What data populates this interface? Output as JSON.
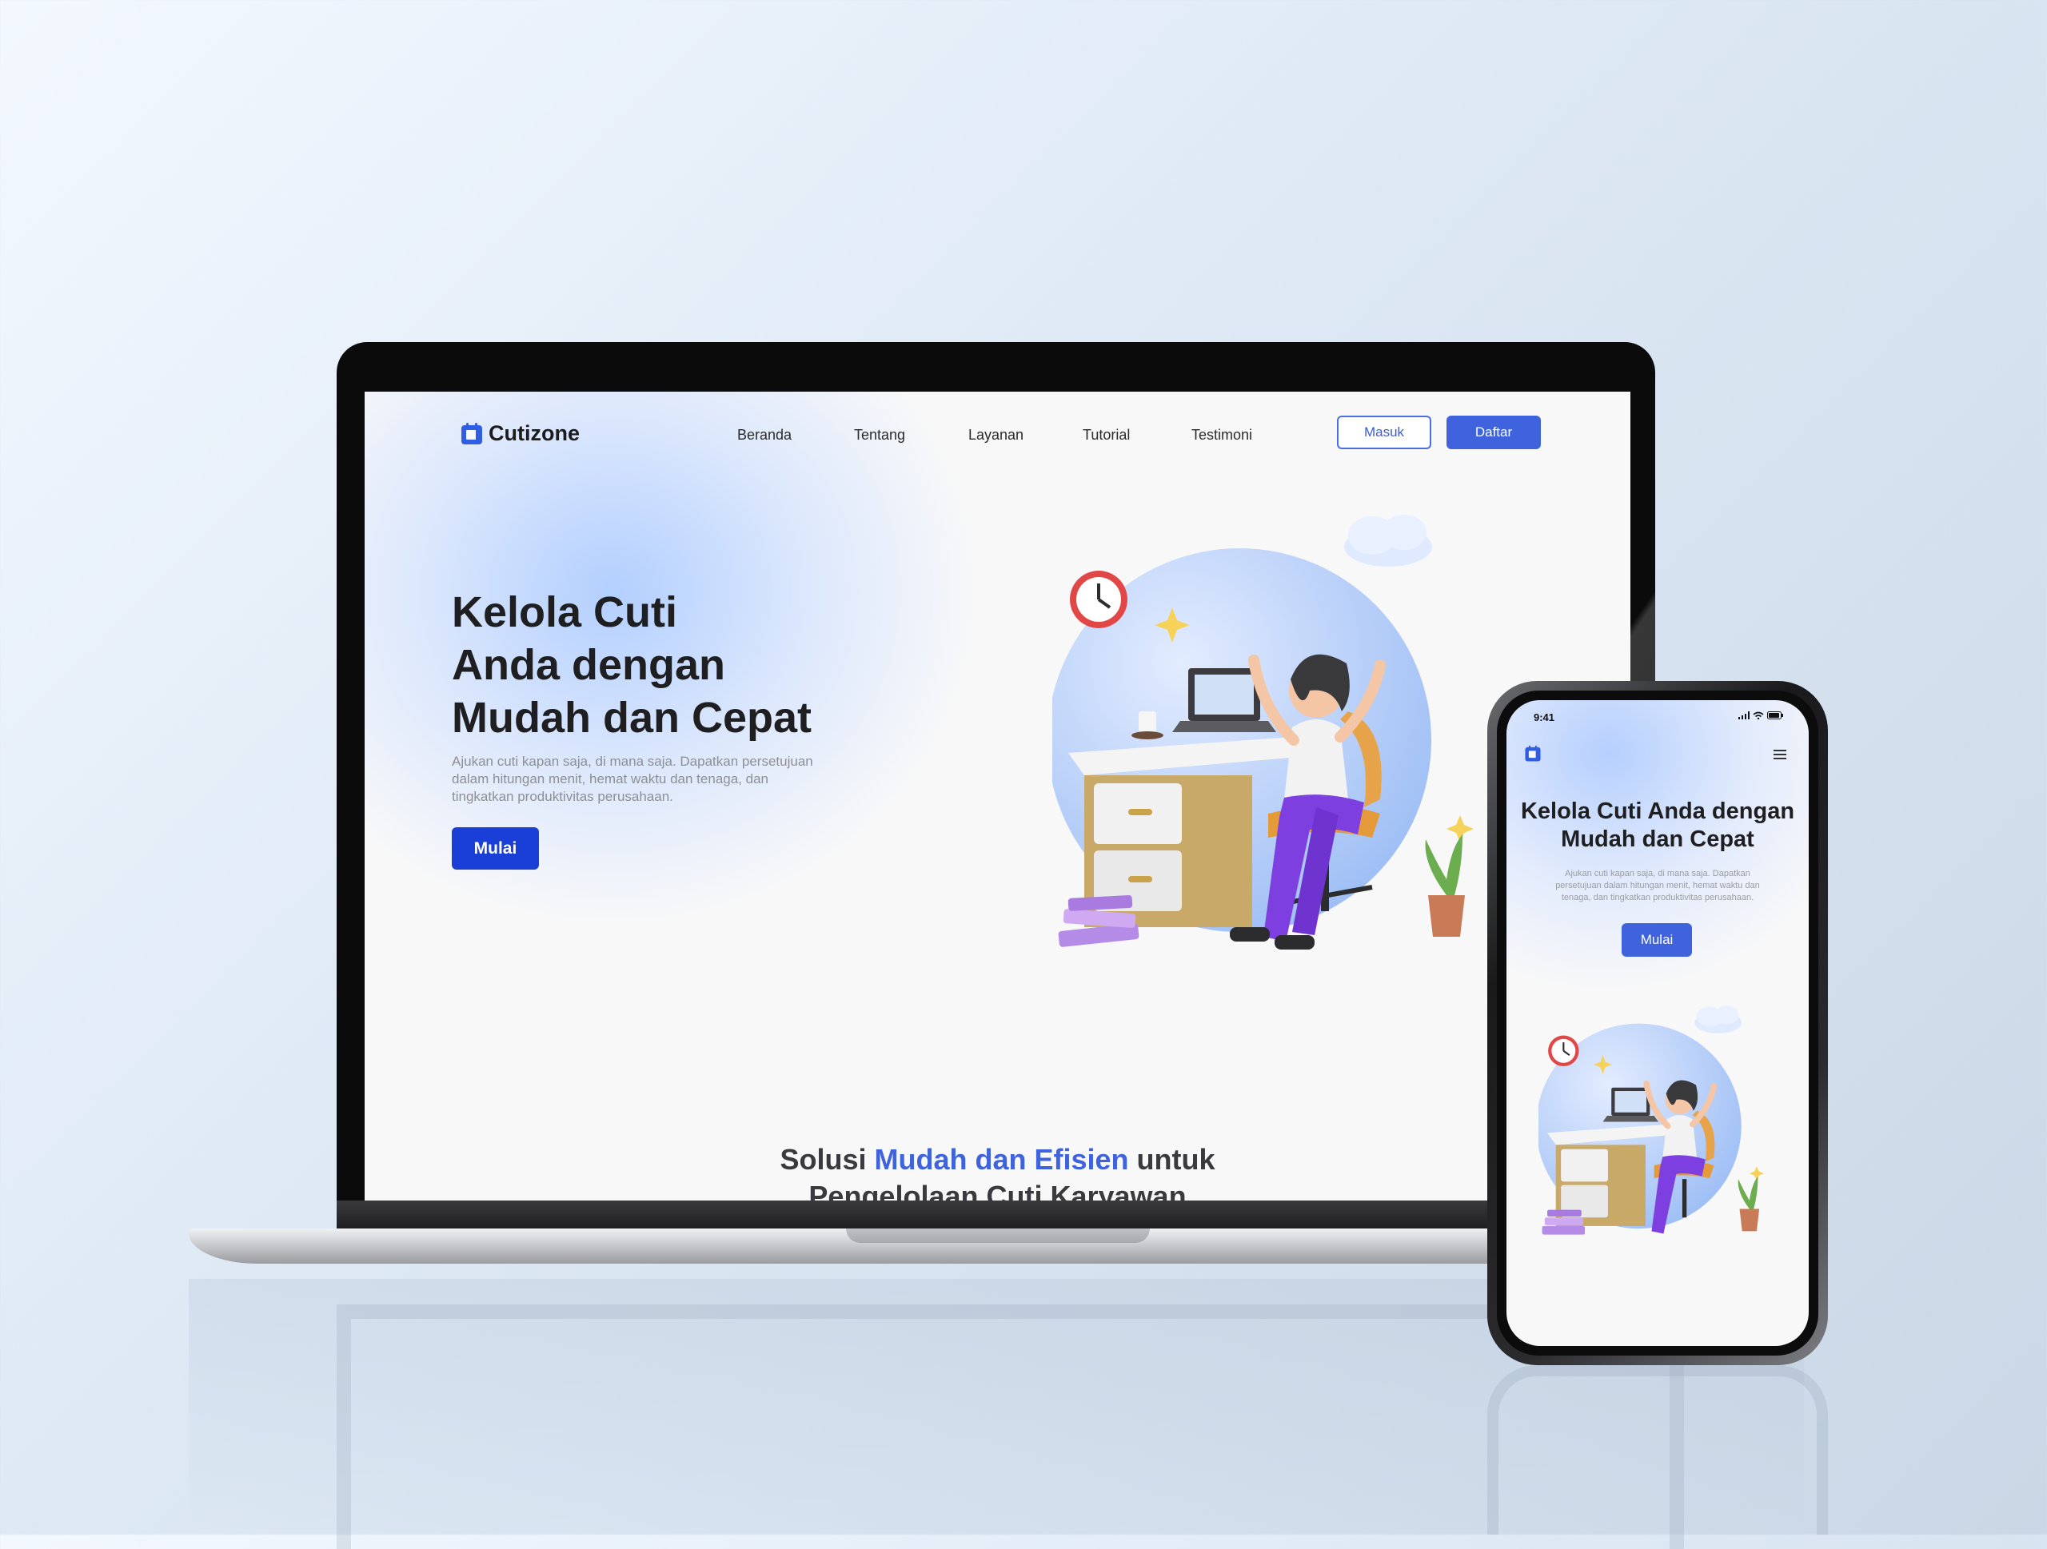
{
  "laptop": {
    "brand": {
      "name": "Cutizone",
      "icon": "calendar-icon"
    },
    "nav": {
      "links": [
        "Beranda",
        "Tentang",
        "Layanan",
        "Tutorial",
        "Testimoni"
      ],
      "login": "Masuk",
      "register": "Daftar"
    },
    "hero": {
      "title_lines": [
        "Kelola Cuti",
        "Anda dengan",
        "Mudah dan Cepat"
      ],
      "subtitle_lines": [
        "Ajukan cuti kapan saja, di mana saja.  Dapatkan persetujuan",
        "dalam hitungan menit, hemat waktu dan tenaga, dan",
        "tingkatkan produktivitas perusahaan."
      ],
      "cta": "Mulai"
    },
    "section": {
      "title_pre": "Solusi ",
      "title_highlight": "Mudah dan Efisien",
      "title_post": " untuk",
      "title_line2": "Pengelolaan Cuti Karyawan"
    }
  },
  "phone": {
    "time": "9:41",
    "status_icons": [
      "signal-icon",
      "wifi-icon",
      "battery-icon"
    ],
    "menu_icon": "hamburger-menu-icon",
    "hero": {
      "title_lines": [
        "Kelola Cuti Anda dengan",
        "Mudah dan Cepat"
      ],
      "subtitle_lines": [
        "Ajukan cuti kapan saja, di mana saja. Dapatkan",
        "persetujuan dalam hitungan menit, hemat waktu dan",
        "tenaga, dan tingkatkan produktivitas perusahaan."
      ],
      "cta": "Mulai"
    }
  },
  "colors": {
    "primary": "#3e63dd",
    "cta_dark": "#1a3fd6",
    "text_dark": "#1f1f22",
    "muted": "#8d8f94",
    "illustration_circle": "#bcd3ff"
  }
}
